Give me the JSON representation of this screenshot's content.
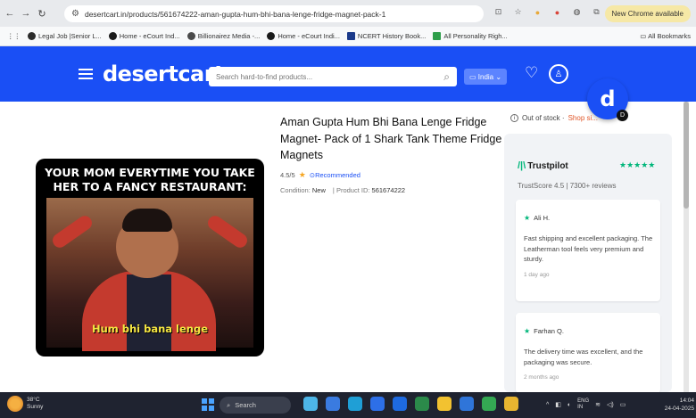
{
  "browser": {
    "url": "desertcart.in/products/561674222-aman-gupta-hum-bhi-bana-lenge-fridge-magnet-pack-1",
    "new_chrome_label": "New Chrome available",
    "bookmarks": [
      {
        "label": "Legal Job |Senior L...",
        "color": "#2b2b2b"
      },
      {
        "label": "Home - eCourt Ind...",
        "color": "#1a1a1a"
      },
      {
        "label": "Billionairez Media -...",
        "color": "#4a4a4a"
      },
      {
        "label": "Home - eCourt Indi...",
        "color": "#1a1a1a"
      },
      {
        "label": "NCERT History Book...",
        "color": "#1b3a8a"
      },
      {
        "label": "All Personality Righ...",
        "color": "#2e9e4a"
      }
    ],
    "all_bookmarks_label": "All Bookmarks"
  },
  "header": {
    "logo": "desertcart",
    "search_placeholder": "Search hard-to-find products...",
    "region": "India",
    "account_icon": "account-icon",
    "wishlist_icon": "heart-icon",
    "brand_color": "#1a4ff5"
  },
  "fab": {
    "letter": "d",
    "badge": "D"
  },
  "product": {
    "title": "Aman Gupta Hum Bhi Bana Lenge Fridge Magnet- Pack of 1 Shark Tank Theme Fridge Magnets",
    "rating": "4.5/5",
    "recommended": "Recommended",
    "condition_label": "Condition:",
    "condition_value": "New",
    "product_id_label": "Product ID:",
    "product_id_value": "561674222",
    "image_top_text": "YOUR MOM EVERYTIME YOU TAKE HER TO A FANCY RESTAURANT:",
    "image_caption": "Hum bhi bana lenge"
  },
  "stock": {
    "status": "Out of stock ·",
    "shop_link": "Shop si..."
  },
  "trustpilot": {
    "name": "Trustpilot",
    "stars": "★★★★★",
    "score": "TrustScore 4.5 | 7300+ reviews",
    "reviews": [
      {
        "name": "Ali H.",
        "text": "Fast shipping and excellent packaging. The Leatherman tool feels very premium and sturdy.",
        "time": "1 day ago"
      },
      {
        "name": "Farhan Q.",
        "text": "The delivery time was excellent, and the packaging was secure.",
        "time": "2 months ago"
      }
    ]
  },
  "taskbar": {
    "weather_temp": "38°C",
    "weather_desc": "Sunny",
    "search_label": "Search",
    "lang": "ENG",
    "lang_region": "IN",
    "time": "14:04",
    "date": "24-04-2025"
  }
}
